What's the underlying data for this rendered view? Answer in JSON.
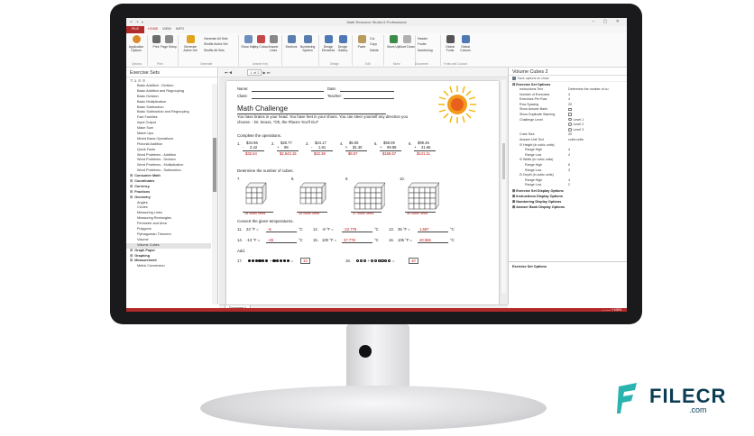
{
  "app": {
    "title": "Math Resource Studio 6 Professional",
    "quick_access": "↶ ↷ ▾",
    "window_controls": "– ▢ ✕",
    "tabs": [
      "FILE",
      "HOME",
      "VIEW",
      "INFO"
    ],
    "ribbon_buttons": [
      {
        "label": "Application Options",
        "icon": "gear-icon",
        "color": "#d98a2b"
      },
      {
        "label": "Print",
        "icon": "printer-icon",
        "color": "#6b6b6b"
      },
      {
        "label": "Page Setup",
        "icon": "page-icon",
        "color": "#8a8a8a"
      },
      {
        "label": "Generate Active Set",
        "icon": "lightning-icon",
        "color": "#e0a51c"
      },
      {
        "label": "Show Key",
        "icon": "key-icon",
        "color": "#6d8fbf"
      },
      {
        "label": "Key Colour",
        "icon": "palette-icon",
        "color": "#c54848"
      },
      {
        "label": "Answer Lines",
        "icon": "lines-icon",
        "color": "#888888"
      },
      {
        "label": "Sections",
        "icon": "sections-icon",
        "color": "#5a7db0"
      },
      {
        "label": "Numbering System",
        "icon": "numbering-icon",
        "color": "#5a7db0"
      },
      {
        "label": "Design Elements",
        "icon": "design-icon",
        "color": "#4f79b5"
      },
      {
        "label": "Design Gallery",
        "icon": "gallery-icon",
        "color": "#4f79b5"
      },
      {
        "label": "Paste",
        "icon": "paste-icon",
        "color": "#b89b5e"
      },
      {
        "label": "Move Up",
        "icon": "arrow-up-icon",
        "color": "#3b8c4a"
      },
      {
        "label": "Move Down",
        "icon": "arrow-down-icon",
        "color": "#b0b0b0"
      },
      {
        "label": "Global Fonts",
        "icon": "font-icon",
        "color": "#555555"
      },
      {
        "label": "Global Colours",
        "icon": "colours-icon",
        "color": "#4f79b5"
      }
    ],
    "ribbon_small": [
      "Generate All Sets",
      "Shuffle Active Set",
      "Shuffle All Sets",
      "Cut",
      "Copy",
      "Delete",
      "Header",
      "Footer",
      "Numbering"
    ],
    "groups": [
      "Options",
      "Print",
      "Generate",
      "Answer Key",
      "Design",
      "Edit",
      "Move",
      "Document",
      "Fonts and Colours"
    ]
  },
  "left_panel": {
    "title": "Exercise Sets",
    "toolbar": "⇈ ⇊ ☰ ☰",
    "items": [
      {
        "label": "Basic Addition - Division",
        "level": 1
      },
      {
        "label": "Basic Addition and Regrouping",
        "level": 1
      },
      {
        "label": "Basic Division",
        "level": 1
      },
      {
        "label": "Basic Multiplication",
        "level": 1
      },
      {
        "label": "Basic Subtraction",
        "level": 1
      },
      {
        "label": "Basic Subtraction and Regrouping",
        "level": 1
      },
      {
        "label": "Fact Families",
        "level": 1
      },
      {
        "label": "Input Output",
        "level": 1
      },
      {
        "label": "Make Sum",
        "level": 1
      },
      {
        "label": "Match Ups",
        "level": 1
      },
      {
        "label": "Mixed Basic Operations",
        "level": 1
      },
      {
        "label": "Pictorial Addition",
        "level": 1
      },
      {
        "label": "Quick Facts",
        "level": 1
      },
      {
        "label": "Word Problems - Addition",
        "level": 1
      },
      {
        "label": "Word Problems - Division",
        "level": 1
      },
      {
        "label": "Word Problems - Multiplication",
        "level": 1
      },
      {
        "label": "Word Problems - Subtraction",
        "level": 1
      },
      {
        "label": "Consumer Math",
        "level": 0
      },
      {
        "label": "Coordinates",
        "level": 0
      },
      {
        "label": "Currency",
        "level": 0
      },
      {
        "label": "Fractions",
        "level": 0
      },
      {
        "label": "Geometry",
        "level": 0
      },
      {
        "label": "Angles",
        "level": 1
      },
      {
        "label": "Circles",
        "level": 1
      },
      {
        "label": "Measuring Lines",
        "level": 1
      },
      {
        "label": "Measuring Rectangles",
        "level": 1
      },
      {
        "label": "Perimeter and Area",
        "level": 1
      },
      {
        "label": "Polygons",
        "level": 1
      },
      {
        "label": "Pythagorean Theorem",
        "level": 1
      },
      {
        "label": "Volume",
        "level": 1
      },
      {
        "label": "Volume Cubes",
        "level": 1,
        "selected": true
      },
      {
        "label": "Graph Paper",
        "level": 0
      },
      {
        "label": "Graphing",
        "level": 0
      },
      {
        "label": "Measurement",
        "level": 0
      },
      {
        "label": "Metric Conversion",
        "level": 1
      }
    ]
  },
  "document": {
    "toolbar_nav": "⏮ ◀",
    "page_indicator": "1 of 2",
    "toolbar_nav2": "▶ ⏭",
    "tab": "Document 1",
    "name_label": "Name:",
    "date_label": "Date:",
    "class_label": "Class:",
    "teacher_label": "Teacher:",
    "title": "Math Challenge",
    "intro": "You have brains in your head. You have feet in your shoes. You can steer yourself any direction you choose. - Dr. Seuss, \"Oh, the Places You'll Go!\"",
    "sections": {
      "operations": "Complete the operations.",
      "cubes": "Determine the number of cubes.",
      "temperatures": "Convert the given temperatures.",
      "add": "Add."
    },
    "operations": [
      {
        "n": "1.",
        "top": "$34.96",
        "op": "-",
        "bottom": "2.42",
        "answer": "$32.54"
      },
      {
        "n": "2.",
        "top": "$26.77",
        "op": "+",
        "bottom": "96",
        "answer": "$2,543.15"
      },
      {
        "n": "3.",
        "top": "$24.17",
        "op": "-",
        "bottom": "1.81",
        "answer": "$22.36"
      },
      {
        "n": "4.",
        "top": "$5.05",
        "op": "×",
        "bottom": "$1.30",
        "answer": "$6.57"
      },
      {
        "n": "5.",
        "top": "$59.09",
        "op": "+",
        "bottom": "99.98",
        "answer": "$158.67"
      },
      {
        "n": "6.",
        "top": "$99.46",
        "op": "+",
        "bottom": "41.65",
        "answer": "$141.11"
      }
    ],
    "cubes": [
      {
        "n": "7.",
        "answer": "16 cubic units"
      },
      {
        "n": "8.",
        "answer": "26 cubic units"
      },
      {
        "n": "9.",
        "answer": "47 cubic units"
      },
      {
        "n": "10.",
        "answer": "49 cubic units"
      }
    ],
    "temps": [
      {
        "n": "11.",
        "q": "23 °F =",
        "a": "-5",
        "u": "°C"
      },
      {
        "n": "12.",
        "q": "-9 °F =",
        "a": "-22.778",
        "u": "°C"
      },
      {
        "n": "13.",
        "q": "35 °F =",
        "a": "1.667",
        "u": "°C"
      },
      {
        "n": "14.",
        "q": "-13 °F =",
        "a": "-25",
        "u": "°C"
      },
      {
        "n": "15.",
        "q": "100 °F =",
        "a": "37.778",
        "u": "°C"
      },
      {
        "n": "16.",
        "q": "105 °F =",
        "a": "40.556",
        "u": "°C"
      }
    ],
    "add_items": [
      {
        "n": "17.",
        "answer": "13"
      },
      {
        "n": "18.",
        "answer": "10"
      }
    ]
  },
  "right_panel": {
    "title": "Volume Cubes 2",
    "toolbar_label": "Save options on close",
    "section_open": "Exercise Set Options",
    "rows": [
      {
        "label": "Instructions Text",
        "value": "Determine the number of cu"
      },
      {
        "label": "Number of Exercises",
        "value": "4"
      },
      {
        "label": "Exercises Per Row",
        "value": "4"
      },
      {
        "label": "Row Spacing",
        "value": "20"
      },
      {
        "label": "Show Answer Bank",
        "value": "",
        "check": true
      },
      {
        "label": "Show Duplicate Warning",
        "value": "",
        "check": true
      },
      {
        "label": "Challenge Level",
        "value": "Level 1",
        "radio": true
      },
      {
        "label": "",
        "value": "Level 2",
        "radio": true
      },
      {
        "label": "",
        "value": "Level 3",
        "radio": true
      },
      {
        "label": "Cube Size",
        "value": "20"
      },
      {
        "label": "Answer Unit Text",
        "value": "cubic units"
      },
      {
        "label": "⊟ Height (in cubic units)",
        "value": ""
      },
      {
        "label": "Range High",
        "value": "4",
        "sub": true
      },
      {
        "label": "Range Low",
        "value": "4",
        "sub": true
      },
      {
        "label": "⊟ Width (in cubic units)",
        "value": ""
      },
      {
        "label": "Range High",
        "value": "6",
        "sub": true
      },
      {
        "label": "Range Low",
        "value": "3",
        "sub": true
      },
      {
        "label": "⊟ Depth (in cubic units)",
        "value": ""
      },
      {
        "label": "Range High",
        "value": "4",
        "sub": true
      },
      {
        "label": "Range Low",
        "value": "2",
        "sub": true
      }
    ],
    "collapsed_sections": [
      "Exercise Set Display Options",
      "Instructions Display Options",
      "Numbering Display Options",
      "Answer Bank Display Options"
    ],
    "description_title": "Exercise Set Options"
  },
  "status": {
    "zoom": "– ─── + 100%"
  },
  "watermark": {
    "brand": "FILECR",
    "domain": ".com"
  }
}
